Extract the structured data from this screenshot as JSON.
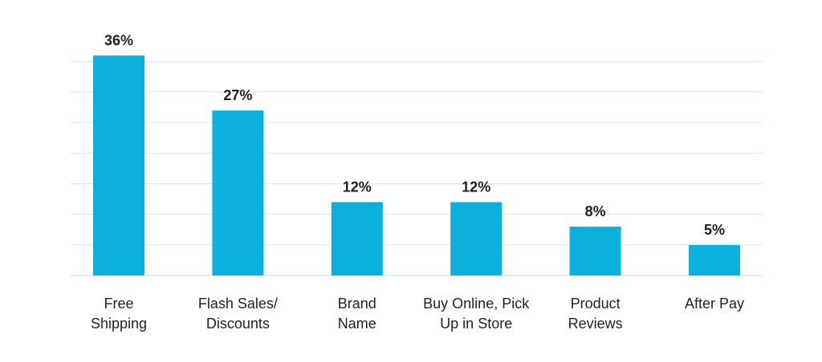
{
  "chart_data": {
    "type": "bar",
    "categories": [
      [
        "Free",
        "Shipping"
      ],
      [
        "Flash Sales/",
        "Discounts"
      ],
      [
        "Brand",
        "Name"
      ],
      [
        "Buy Online, Pick",
        "Up in Store"
      ],
      [
        "Product",
        "Reviews"
      ],
      [
        "After Pay"
      ]
    ],
    "values": [
      36,
      27,
      12,
      12,
      8,
      5
    ],
    "data_labels": [
      "36%",
      "27%",
      "12%",
      "12%",
      "8%",
      "5%"
    ],
    "ylim": [
      0,
      35
    ],
    "grid": true,
    "title": "",
    "xlabel": "",
    "ylabel": ""
  },
  "colors": {
    "bar": "#0cb0dc",
    "grid": "#cfe8f3",
    "text": "#1f1f1f"
  }
}
